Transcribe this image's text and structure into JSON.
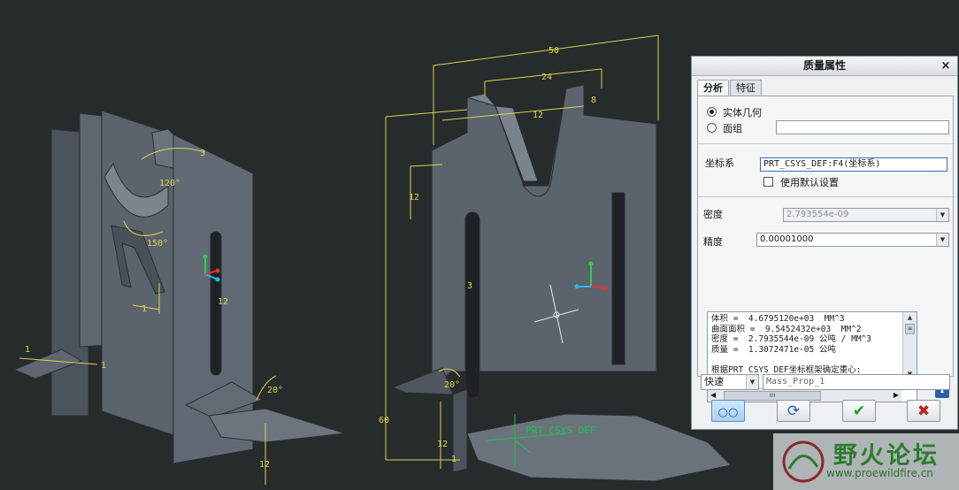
{
  "viewport": {
    "dimensions": [
      "50",
      "24",
      "12",
      "8",
      "12",
      "3",
      "1",
      "12",
      "60",
      "12",
      "20°",
      "20°",
      "120°",
      "150°",
      "3",
      "1",
      "1",
      "12",
      "1"
    ],
    "csys_label": "PRT_CSYS_DEF",
    "colors": {
      "background": "#262b2c",
      "part": "#5b636c",
      "dimension": "#e0d24a",
      "csys": "#1fc04a"
    }
  },
  "dialog": {
    "title": "质量属性",
    "close_glyph": "×",
    "tabs": [
      "分析",
      "特征"
    ],
    "geometry_options": [
      "实体几何",
      "面组"
    ],
    "coordsys_label": "坐标系",
    "coordsys_value": "PRT_CSYS_DEF:F4(坐标系)",
    "use_default_label": "使用默认设置",
    "density_label": "密度",
    "density_value": "2.793554e-09",
    "accuracy_label": "精度",
    "accuracy_value": "0.00001000",
    "results": "体积 =  4.6795120e+03  MM^3\n曲面面积 =  9.5452432e+03  MM^2\n密度 =  2.7935544e-09 公吨 / MM^3\n质量 =  1.3072471e-05 公吨\n\n根据PRT_CSYS_DEF坐标框架确定重心:",
    "scroll_thumb_grip": "IIII",
    "info_glyph": "i",
    "mode_value": "快速",
    "name_value": "Mass_Prop_1",
    "icons": [
      "preview-glasses-icon",
      "recompute-icon",
      "ok-check-icon",
      "cancel-x-icon"
    ]
  },
  "watermark": {
    "title": "野火论坛",
    "url": "www.proewildfire.cn"
  }
}
